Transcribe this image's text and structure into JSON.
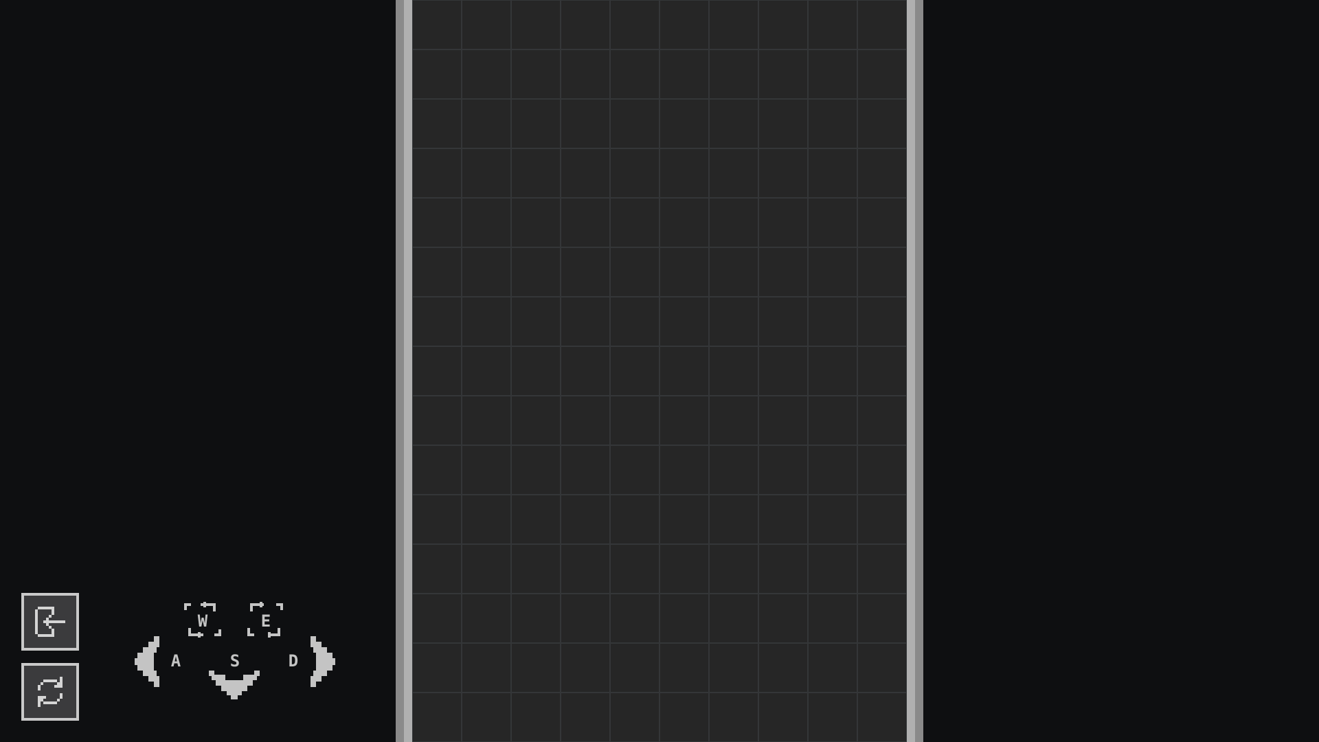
{
  "colors": {
    "background": "#0e0f11",
    "well_background": "#262626",
    "grid_line": "#343638",
    "frame_outer": "#8a8a8a",
    "frame_inner": "#b0b0b0",
    "button_fill": "#3b3b3d",
    "button_border": "#c9c9c9",
    "hint_color": "#c4c4c4"
  },
  "well": {
    "columns": 10,
    "rows": 15
  },
  "side_buttons": [
    {
      "name": "exit-button",
      "icon": "exit-icon"
    },
    {
      "name": "restart-button",
      "icon": "restart-icon"
    }
  ],
  "controls": {
    "rotate_ccw_key": "W",
    "rotate_cw_key": "E",
    "left_key": "A",
    "down_key": "S",
    "right_key": "D"
  }
}
